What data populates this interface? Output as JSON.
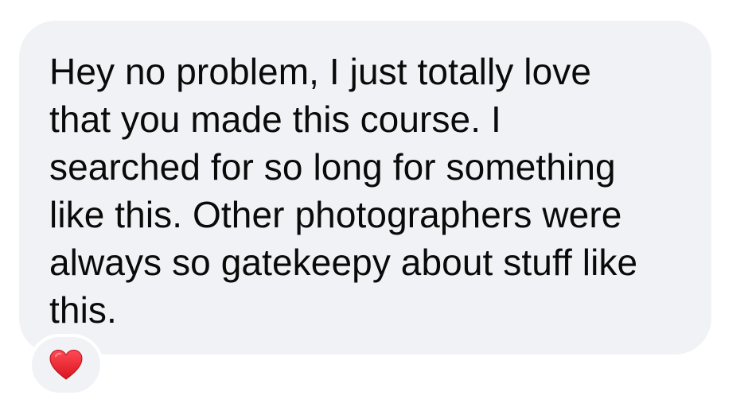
{
  "message": {
    "lines": [
      "Hey no problem, I just totally love",
      "that you made this course. I",
      "searched for so long for something",
      "like this. Other photographers were",
      "always so gatekeepy about stuff like",
      "this."
    ]
  },
  "reaction": {
    "icon": "red-heart-icon",
    "color": "#e8202e"
  },
  "colors": {
    "bubble_background": "#f1f2f5",
    "text": "#0a0a0a",
    "page_background": "#ffffff"
  }
}
